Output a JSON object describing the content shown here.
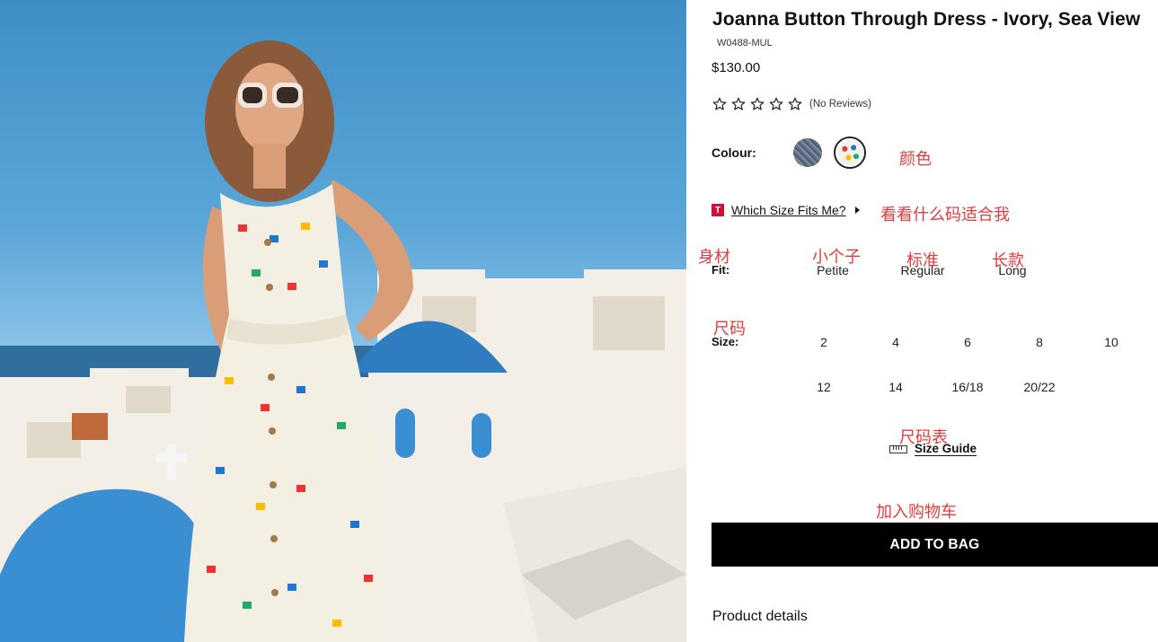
{
  "product": {
    "title": "Joanna Button Through Dress - Ivory, Sea View",
    "sku": "W0488-MUL",
    "price": "$130.00",
    "rating_stars": 0,
    "reviews_label": "(No Reviews)"
  },
  "colour": {
    "label": "Colour:",
    "options": [
      "denim-swatch",
      "sea-view-print-swatch"
    ],
    "selected": "sea-view-print-swatch"
  },
  "size_fit": {
    "link_text": "Which Size Fits Me?",
    "badge": "T"
  },
  "fit": {
    "label": "Fit:",
    "options": [
      "Petite",
      "Regular",
      "Long"
    ]
  },
  "size": {
    "label": "Size:",
    "options": [
      "2",
      "4",
      "6",
      "8",
      "10",
      "12",
      "14",
      "16/18",
      "20/22"
    ]
  },
  "size_guide": {
    "label": "Size Guide"
  },
  "add_to_bag": {
    "label": "ADD TO BAG"
  },
  "details": {
    "label": "Product details"
  },
  "annotations": {
    "colour": "颜色",
    "size_fit": "看看什么码适合我",
    "fit": "身材",
    "petite": "小个子",
    "regular": "标准",
    "long": "长款",
    "size": "尺码",
    "size_guide": "尺码表",
    "add_to_bag": "加入购物车"
  },
  "colors": {
    "annotation": "#e23b3b",
    "button_bg": "#000000",
    "badge": "#d0103a"
  }
}
